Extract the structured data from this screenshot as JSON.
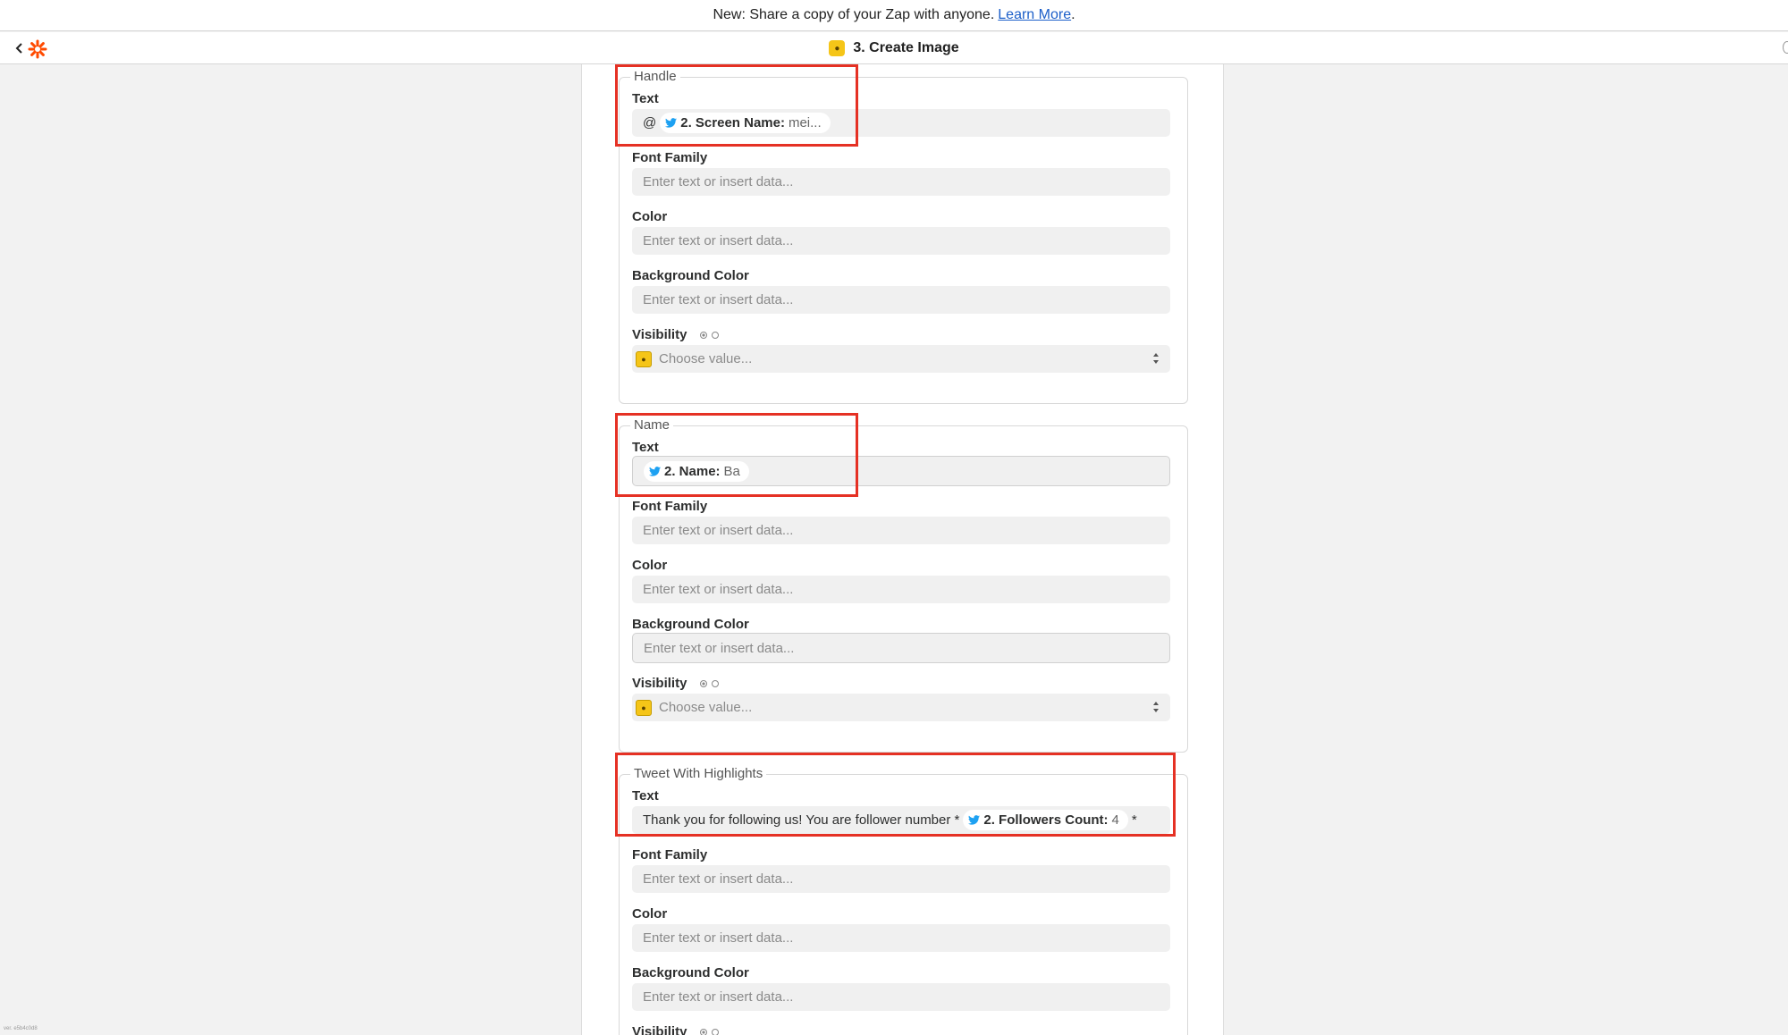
{
  "banner": {
    "text": "New: Share a copy of your Zap with anyone.",
    "link": "Learn More",
    "end": "."
  },
  "header": {
    "step_title": "3. Create Image"
  },
  "placeholder": "Enter text or insert data...",
  "select_placeholder": "Choose value...",
  "labels": {
    "text": "Text",
    "font_family": "Font Family",
    "color": "Color",
    "background_color": "Background Color",
    "visibility": "Visibility"
  },
  "groups": [
    {
      "legend": "Handle",
      "text_prefix": "@",
      "pill_label": "2. Screen Name:",
      "pill_value": "mei..."
    },
    {
      "legend": "Name",
      "pill_label": "2. Name:",
      "pill_value": "Ba"
    },
    {
      "legend": "Tweet With Highlights",
      "text_prefix": "Thank you for following us!  You are follower number *",
      "pill_label": "2. Followers Count:",
      "pill_value": "4",
      "text_suffix": "*"
    }
  ],
  "version": "ver. e5b4c0d8"
}
